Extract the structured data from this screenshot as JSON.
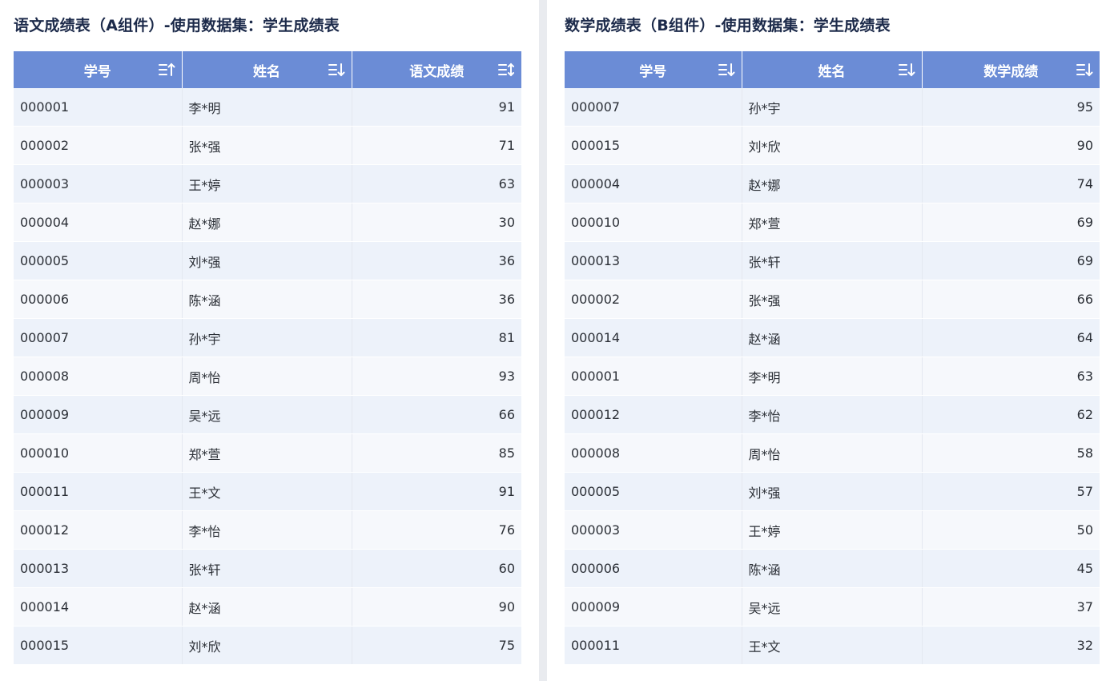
{
  "panel_a": {
    "title": "语文成绩表（A组件）-使用数据集：学生成绩表",
    "columns": [
      "学号",
      "姓名",
      "语文成绩"
    ],
    "sort_icons": [
      "sort-ascending-icon",
      "sort-descending-icon",
      "sort-toggle-icon"
    ],
    "rows": [
      [
        "000001",
        "李*明",
        "91"
      ],
      [
        "000002",
        "张*强",
        "71"
      ],
      [
        "000003",
        "王*婷",
        "63"
      ],
      [
        "000004",
        "赵*娜",
        "30"
      ],
      [
        "000005",
        "刘*强",
        "36"
      ],
      [
        "000006",
        "陈*涵",
        "36"
      ],
      [
        "000007",
        "孙*宇",
        "81"
      ],
      [
        "000008",
        "周*怡",
        "93"
      ],
      [
        "000009",
        "吴*远",
        "66"
      ],
      [
        "000010",
        "郑*萱",
        "85"
      ],
      [
        "000011",
        "王*文",
        "91"
      ],
      [
        "000012",
        "李*怡",
        "76"
      ],
      [
        "000013",
        "张*轩",
        "60"
      ],
      [
        "000014",
        "赵*涵",
        "90"
      ],
      [
        "000015",
        "刘*欣",
        "75"
      ]
    ]
  },
  "panel_b": {
    "title": "数学成绩表（B组件）-使用数据集：学生成绩表",
    "columns": [
      "学号",
      "姓名",
      "数学成绩"
    ],
    "sort_icons": [
      "sort-descending-icon",
      "sort-descending-icon",
      "sort-descending-icon"
    ],
    "rows": [
      [
        "000007",
        "孙*宇",
        "95"
      ],
      [
        "000015",
        "刘*欣",
        "90"
      ],
      [
        "000004",
        "赵*娜",
        "74"
      ],
      [
        "000010",
        "郑*萱",
        "69"
      ],
      [
        "000013",
        "张*轩",
        "69"
      ],
      [
        "000002",
        "张*强",
        "66"
      ],
      [
        "000014",
        "赵*涵",
        "64"
      ],
      [
        "000001",
        "李*明",
        "63"
      ],
      [
        "000012",
        "李*怡",
        "62"
      ],
      [
        "000008",
        "周*怡",
        "58"
      ],
      [
        "000005",
        "刘*强",
        "57"
      ],
      [
        "000003",
        "王*婷",
        "50"
      ],
      [
        "000006",
        "陈*涵",
        "45"
      ],
      [
        "000009",
        "吴*远",
        "37"
      ],
      [
        "000011",
        "王*文",
        "32"
      ]
    ]
  },
  "colors": {
    "header_bg": "#6b8cd6",
    "row_odd": "#edf2fa",
    "row_even": "#f6f8fc",
    "title": "#1c2a4a"
  }
}
